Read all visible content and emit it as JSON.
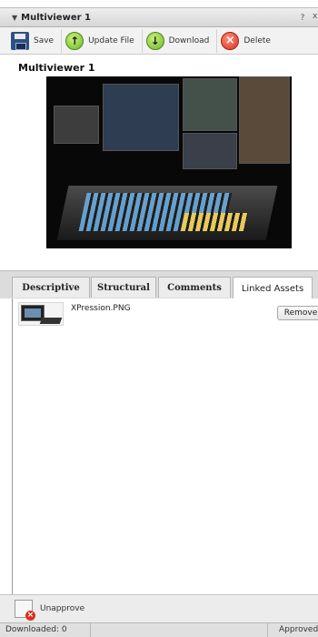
{
  "window": {
    "title": "Multiviewer 1",
    "help_label": "?",
    "close_label": "x"
  },
  "toolbar": {
    "save_label": "Save",
    "update_label": "Update File",
    "download_label": "Download",
    "delete_label": "Delete"
  },
  "asset": {
    "title": "Multiviewer 1"
  },
  "tabs": [
    {
      "label": "Descriptive",
      "active": false
    },
    {
      "label": "Structural",
      "active": false
    },
    {
      "label": "Comments",
      "active": false
    },
    {
      "label": "Linked Assets",
      "active": true
    }
  ],
  "linked_assets": [
    {
      "filename": "XPression.PNG",
      "remove_label": "Remove"
    }
  ],
  "footer": {
    "unapprove_label": "Unapprove"
  },
  "status": {
    "downloaded": "Downloaded: 0",
    "approval": "Approved"
  },
  "colors": {
    "accent_green": "#6eb82a",
    "delete_red": "#d9331f"
  }
}
